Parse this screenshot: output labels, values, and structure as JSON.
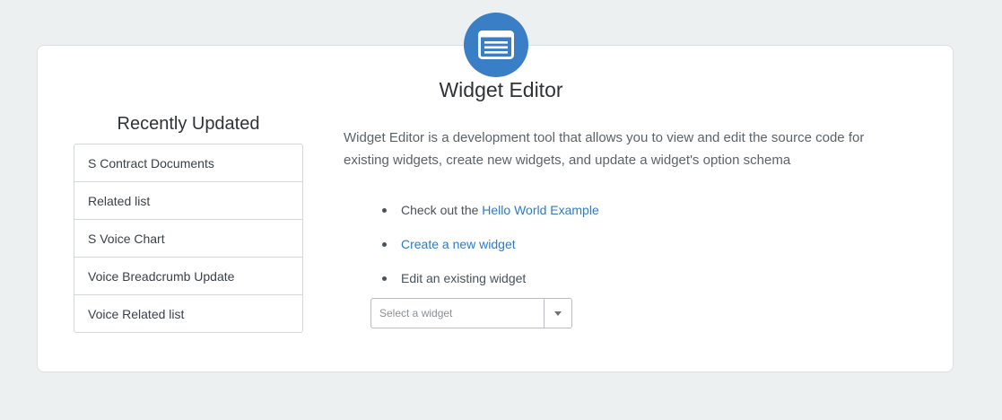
{
  "header": {
    "icon": "list-widget-icon",
    "title": "Widget Editor",
    "accent_color": "#3a7fc5"
  },
  "recent": {
    "heading": "Recently Updated",
    "items": [
      {
        "label": "S Contract Documents"
      },
      {
        "label": "Related list"
      },
      {
        "label": "S Voice Chart"
      },
      {
        "label": "Voice Breadcrumb Update"
      },
      {
        "label": "Voice Related list"
      }
    ]
  },
  "main": {
    "description": "Widget Editor is a development tool that allows you to view and edit the source code for existing widgets, create new widgets, and update a widget's option schema",
    "bullets": {
      "hello_prefix": "Check out the ",
      "hello_link": "Hello World Example",
      "create_link": "Create a new widget",
      "edit_text": "Edit an existing widget"
    },
    "select": {
      "placeholder": "Select a widget",
      "arrow_icon": "caret-down-icon"
    }
  }
}
